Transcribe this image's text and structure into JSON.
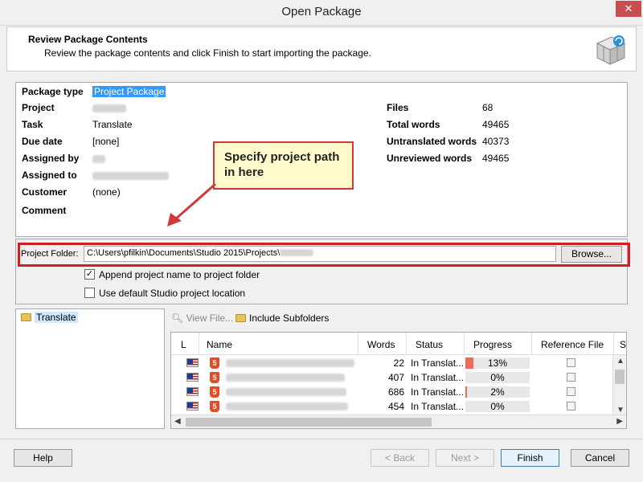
{
  "window": {
    "title": "Open Package",
    "close_glyph": "✕"
  },
  "header": {
    "title": "Review Package Contents",
    "subtitle": "Review the package contents and click Finish to start importing the package."
  },
  "package_info": {
    "left": [
      {
        "label": "Package type",
        "value": "Project Package",
        "selected": true
      },
      {
        "label": "Project",
        "value": "",
        "blurred": true
      },
      {
        "label": "Task",
        "value": "Translate"
      },
      {
        "label": "Due date",
        "value": "[none]"
      },
      {
        "label": "Assigned by",
        "value": "",
        "blurred": true
      },
      {
        "label": "Assigned to",
        "value": "",
        "blurred": true
      },
      {
        "label": "Customer",
        "value": "(none)"
      },
      {
        "label": "Comment",
        "value": ""
      }
    ],
    "right": [
      {
        "label": "Files",
        "value": "68"
      },
      {
        "label": "Total words",
        "value": "49465"
      },
      {
        "label": "Untranslated words",
        "value": "40373"
      },
      {
        "label": "Unreviewed words",
        "value": "49465"
      }
    ]
  },
  "callout": {
    "text": "Specify project path in here"
  },
  "project_folder": {
    "label": "Project Folder:",
    "value": "C:\\Users\\pfilkin\\Documents\\Studio 2015\\Projects\\",
    "browse_label": "Browse..."
  },
  "options": [
    {
      "label": "Append project name to project folder",
      "checked": true
    },
    {
      "label": "Use default Studio project location",
      "checked": false
    }
  ],
  "tree": {
    "item": "Translate"
  },
  "toolbar": {
    "view_file": "View File...",
    "include_subfolders": "Include Subfolders"
  },
  "grid": {
    "columns": [
      "L",
      "Name",
      "Words",
      "Status",
      "Progress",
      "Reference File",
      "S"
    ],
    "rows": [
      {
        "words": "22",
        "status": "In Translat...",
        "progress": "13%",
        "progress_value": 13
      },
      {
        "words": "407",
        "status": "In Translat...",
        "progress": "0%",
        "progress_value": 0
      },
      {
        "words": "686",
        "status": "In Translat...",
        "progress": "2%",
        "progress_value": 2
      },
      {
        "words": "454",
        "status": "In Translat...",
        "progress": "0%",
        "progress_value": 0
      }
    ]
  },
  "buttons": {
    "help": "Help",
    "back": "< Back",
    "next": "Next >",
    "finish": "Finish",
    "cancel": "Cancel"
  },
  "colors": {
    "callout_border": "#d23a3a",
    "highlight_border": "#d02020",
    "progress_fill": "#f26a5a",
    "selection": "#3399ff"
  }
}
